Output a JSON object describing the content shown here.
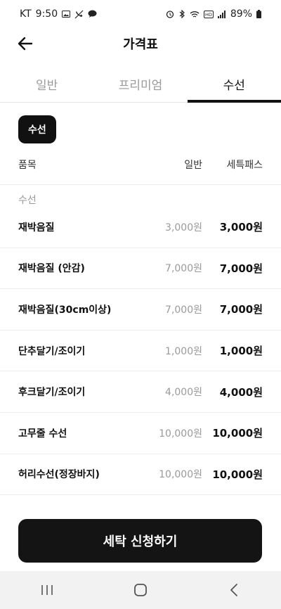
{
  "status_bar": {
    "carrier": "KT",
    "time": "9:50",
    "battery": "89%",
    "left_icons": [
      "image-icon",
      "muted-call-icon",
      "chat-icon"
    ],
    "right_icons": [
      "alarm-icon",
      "bluetooth-icon",
      "wifi-icon",
      "hd-icon",
      "signal-icon",
      "battery-icon"
    ]
  },
  "header": {
    "title": "가격표",
    "back_icon": "arrow-left-icon"
  },
  "tabs": [
    {
      "label": "일반",
      "active": false
    },
    {
      "label": "프리미엄",
      "active": false
    },
    {
      "label": "수선",
      "active": true
    }
  ],
  "category_chip": "수선",
  "columns": {
    "item": "품목",
    "normal": "일반",
    "pass": "세특패스"
  },
  "section_label": "수선",
  "items": [
    {
      "name": "재박음질",
      "normal": "3,000원",
      "pass": "3,000원"
    },
    {
      "name": "재박음질 (안감)",
      "normal": "7,000원",
      "pass": "7,000원"
    },
    {
      "name": "재박음질(30cm이상)",
      "normal": "7,000원",
      "pass": "7,000원"
    },
    {
      "name": "단추달기/조이기",
      "normal": "1,000원",
      "pass": "1,000원"
    },
    {
      "name": "후크달기/조이기",
      "normal": "4,000원",
      "pass": "4,000원"
    },
    {
      "name": "고무줄 수선",
      "normal": "10,000원",
      "pass": "10,000원"
    },
    {
      "name": "허리수선(정장바지)",
      "normal": "10,000원",
      "pass": "10,000원"
    }
  ],
  "cta": {
    "label": "세탁 신청하기"
  },
  "nav": {
    "recent_icon": "recent-apps-icon",
    "home_icon": "home-icon",
    "back_icon": "back-chevron-icon"
  },
  "colors": {
    "accent": "#111111",
    "muted_text": "#9a9a9a",
    "divider": "#ececec",
    "nav_bg": "#f2f2f2"
  }
}
